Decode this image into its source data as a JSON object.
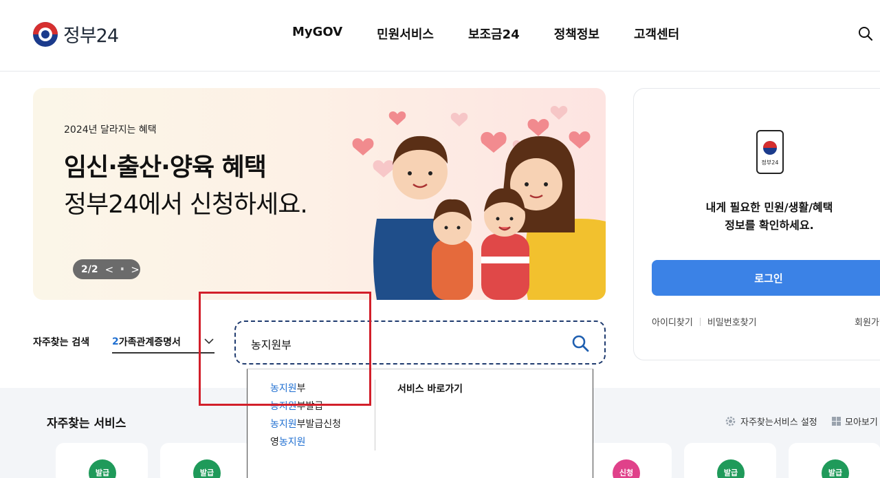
{
  "header": {
    "logo_text": "정부24",
    "nav": [
      "MyGOV",
      "민원서비스",
      "보조금24",
      "정책정보",
      "고객센터"
    ],
    "search_icon": "search-icon"
  },
  "banner": {
    "subtitle": "2024년 달라지는 혜택",
    "title": "임신·출산·양육 혜택",
    "title2": "정부24에서 신청하세요.",
    "page": "2/2",
    "prev_symbol": "<",
    "pause_symbol": "⏸",
    "next_symbol": ">"
  },
  "login": {
    "phone_label": "정부24",
    "message_line1": "내게 필요한 민원/생활/혜택",
    "message_line2": "정보를 확인하세요.",
    "button": "로그인",
    "find_id": "아이디찾기",
    "find_pw": "비밀번호찾기",
    "signup": "회원가입"
  },
  "frequent_search": {
    "label": "자주찾는 검색",
    "selected_num": "2",
    "selected_text": "가족관계증명서"
  },
  "search": {
    "value": "농지원부"
  },
  "autocomplete": {
    "items": [
      {
        "hl": "농지원",
        "rest": "부",
        "pre": ""
      },
      {
        "hl": "농지원",
        "rest": "부발급",
        "pre": ""
      },
      {
        "hl": "농지원",
        "rest": "부발급신청",
        "pre": ""
      },
      {
        "hl": "농지원",
        "rest": "",
        "pre": "영"
      }
    ],
    "shortcut_title": "서비스 바로가기"
  },
  "services": {
    "title": "자주찾는 서비스",
    "settings": "자주찾는서비스 설정",
    "view_all": "모아보기",
    "badges": [
      "발급",
      "발급",
      "신청",
      "발급",
      "발급"
    ]
  },
  "colors": {
    "accent": "#3b82e6",
    "highlight_box": "#d21f2a",
    "badge_green": "#1f9a5a",
    "badge_pink": "#e0418a"
  }
}
